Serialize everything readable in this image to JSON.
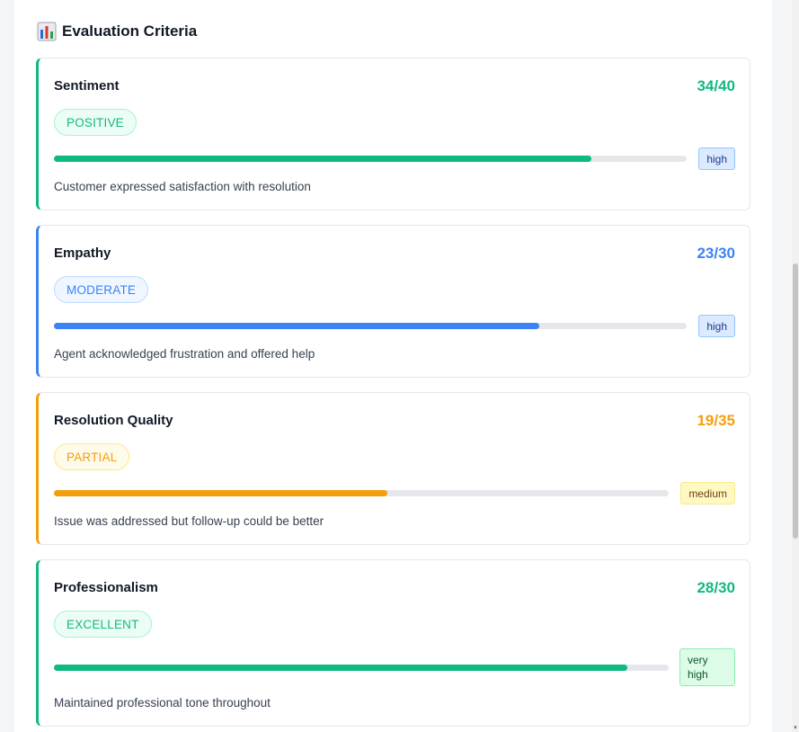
{
  "section": {
    "title": "Evaluation Criteria",
    "icon": "bar-chart-icon"
  },
  "criteria": [
    {
      "name": "Sentiment",
      "score": "34/40",
      "fraction": 0.85,
      "badge": "POSITIVE",
      "confidence": "high",
      "description": "Customer expressed satisfaction with resolution",
      "accent": "#10b981",
      "badge_bg": "#ecfdf5",
      "badge_border": "#a7f3d0",
      "badge_text": "#10b981",
      "conf_bg": "#dbeafe",
      "conf_border": "#93c5fd",
      "conf_text": "#1e3a8a"
    },
    {
      "name": "Empathy",
      "score": "23/30",
      "fraction": 0.767,
      "badge": "MODERATE",
      "confidence": "high",
      "description": "Agent acknowledged frustration and offered help",
      "accent": "#3b82f6",
      "badge_bg": "#eff6ff",
      "badge_border": "#bfdbfe",
      "badge_text": "#3b82f6",
      "conf_bg": "#dbeafe",
      "conf_border": "#93c5fd",
      "conf_text": "#1e3a8a"
    },
    {
      "name": "Resolution Quality",
      "score": "19/35",
      "fraction": 0.543,
      "badge": "PARTIAL",
      "confidence": "medium",
      "description": "Issue was addressed but follow-up could be better",
      "accent": "#f59e0b",
      "badge_bg": "#fffbeb",
      "badge_border": "#fde68a",
      "badge_text": "#f59e0b",
      "conf_bg": "#fef9c3",
      "conf_border": "#fde68a",
      "conf_text": "#713f12"
    },
    {
      "name": "Professionalism",
      "score": "28/30",
      "fraction": 0.933,
      "badge": "EXCELLENT",
      "confidence_lines": [
        "very",
        "high"
      ],
      "description": "Maintained professional tone throughout",
      "accent": "#10b981",
      "badge_bg": "#ecfdf5",
      "badge_border": "#a7f3d0",
      "badge_text": "#10b981",
      "conf_bg": "#dcfce7",
      "conf_border": "#86efac",
      "conf_text": "#14532d"
    }
  ]
}
